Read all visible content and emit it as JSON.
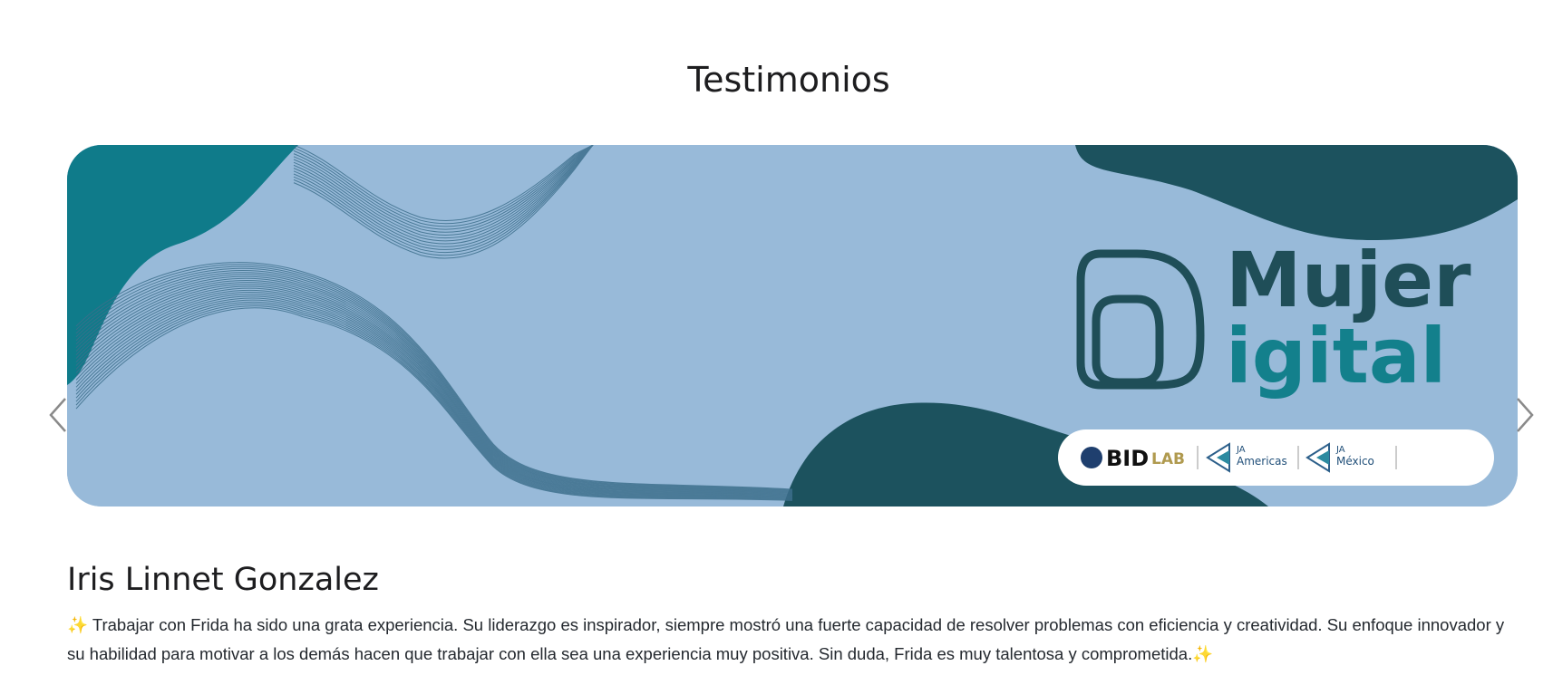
{
  "section": {
    "title": "Testimonios"
  },
  "banner": {
    "logo_line1": "Mujer",
    "logo_line2": "igital",
    "partners": {
      "bid": "BID",
      "lab": "LAB",
      "ja_americas_top": "JA",
      "ja_americas_bottom": "Americas",
      "ja_mexico_top": "JA",
      "ja_mexico_bottom": "México"
    },
    "colors": {
      "background": "#98bad9",
      "teal": "#0f7b8a",
      "dark_teal": "#1c525e",
      "logo_dark": "#1f4e58",
      "logo_teal": "#13808c"
    }
  },
  "carousel": {
    "prev_icon": "chevron-left-icon",
    "next_icon": "chevron-right-icon"
  },
  "testimonial": {
    "author": "Iris Linnet Gonzalez",
    "sparkle": "✨",
    "text": "Trabajar con Frida ha sido una grata experiencia. Su liderazgo es inspirador, siempre mostró una fuerte capacidad de resolver problemas con eficiencia y creatividad. Su enfoque innovador y su habilidad para motivar a los demás hacen que trabajar con ella sea una experiencia muy positiva. Sin duda, Frida es muy talentosa y comprometida."
  }
}
